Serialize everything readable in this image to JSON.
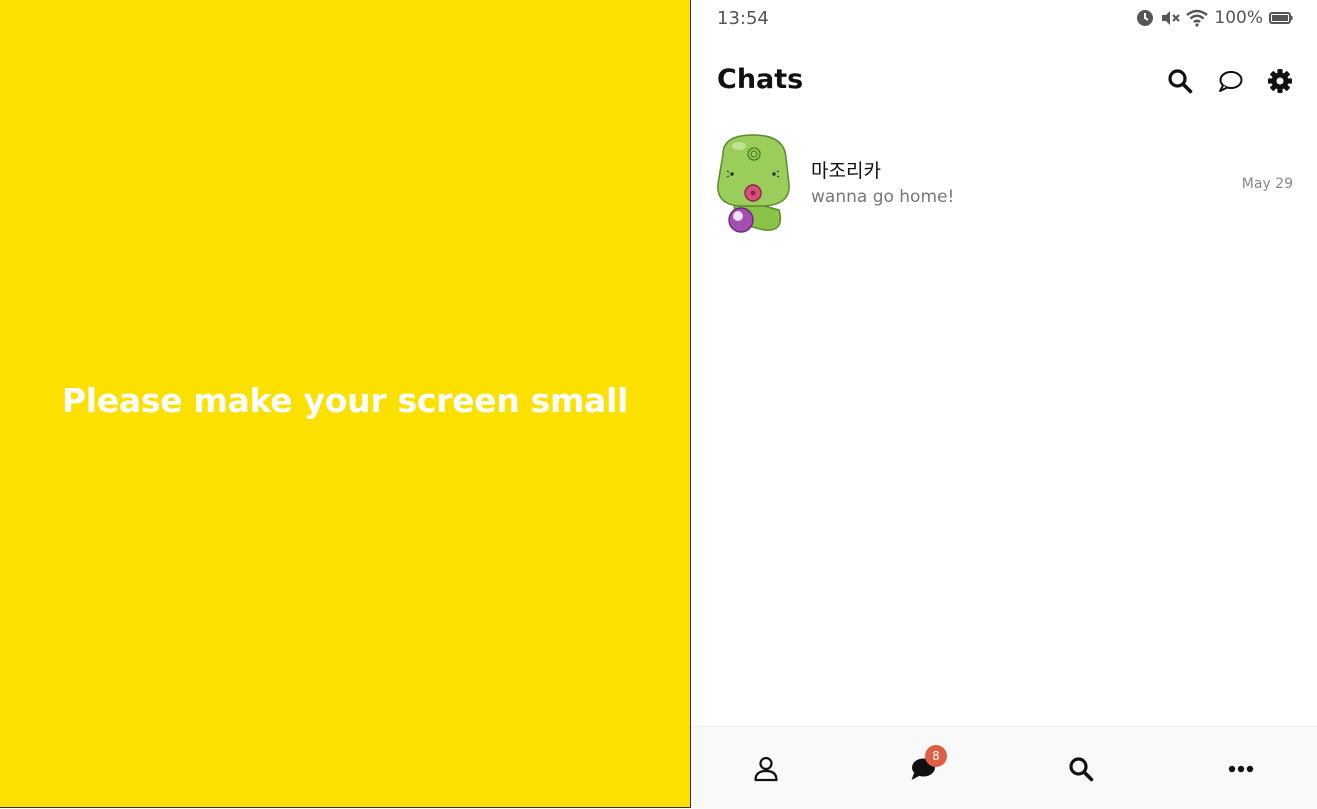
{
  "left_panel": {
    "message": "Please make your screen small",
    "background": "#FCE000"
  },
  "status_bar": {
    "time": "13:54",
    "battery": "100%"
  },
  "header": {
    "title": "Chats",
    "icons": [
      "search-icon",
      "chat-bubble-icon",
      "gear-icon"
    ]
  },
  "chats": [
    {
      "name": "마조리카",
      "preview": "wanna go home!",
      "date": "May 29"
    }
  ],
  "tab_bar": {
    "icons": [
      "person-icon",
      "chat-icon",
      "search-icon",
      "more-icon"
    ],
    "chat_badge": "8",
    "badge_color": "#E25E42"
  }
}
